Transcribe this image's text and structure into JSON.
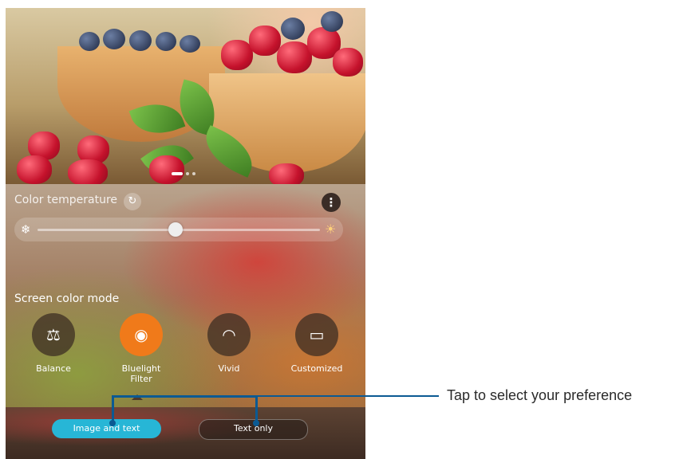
{
  "color_temperature": {
    "label": "Color temperature",
    "refresh_icon": "refresh-icon",
    "more_icon": "more-options-icon",
    "slider_value": 0.49,
    "cold_icon": "snowflake-icon",
    "warm_icon": "sun-icon"
  },
  "screen_color_mode": {
    "title": "Screen color mode",
    "modes": [
      {
        "label": "Balance",
        "icon": "balance-scale-icon",
        "glyph": "⚖",
        "selected": false
      },
      {
        "label": "Bluelight Filter",
        "icon": "eye-shield-icon",
        "glyph": "◉",
        "selected": true
      },
      {
        "label": "Vivid",
        "icon": "vivid-arcs-icon",
        "glyph": "◠",
        "selected": false
      },
      {
        "label": "Customized",
        "icon": "customized-screen-icon",
        "glyph": "▭",
        "selected": false
      }
    ],
    "accent_color": "#f07a1a"
  },
  "options": {
    "image_and_text": "Image and text",
    "text_only": "Text only",
    "selected": "Image and text",
    "selected_color": "#27b6d6"
  },
  "callout": {
    "text": "Tap to select your preference",
    "line_color": "#0b5a93"
  }
}
